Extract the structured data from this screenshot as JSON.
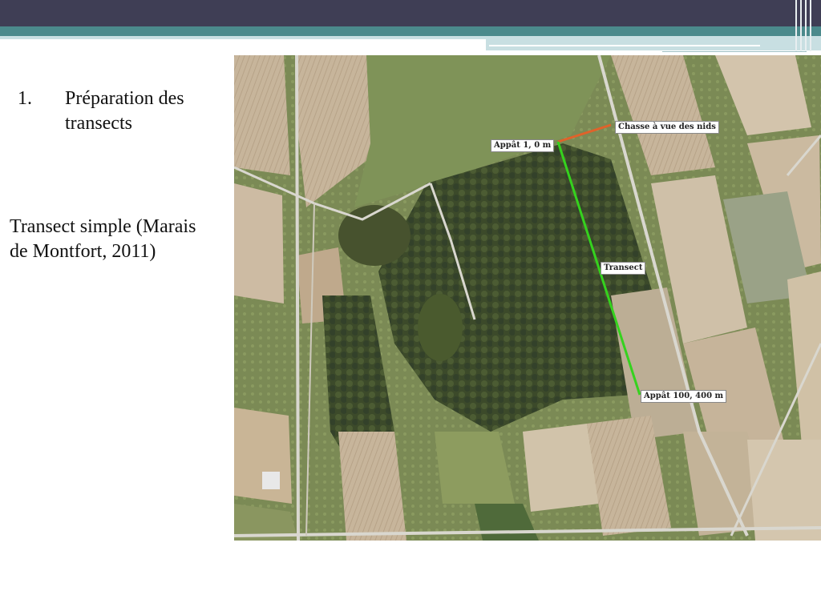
{
  "slide": {
    "list": [
      {
        "number": "1.",
        "text": "Préparation des transects"
      }
    ],
    "paragraph": "Transect simple (Marais de Montfort, 2011)"
  },
  "map": {
    "labels": {
      "nest_search": "Chasse à vue des nids",
      "bait_start": "Appât 1, 0 m",
      "transect": "Transect",
      "bait_end": "Appât 100, 400 m"
    },
    "colors": {
      "transect_line": "#35d21e",
      "nest_line": "#e0622a"
    }
  },
  "theme": {
    "header_dark": "#3f3e55",
    "header_teal": "#4b8a8c",
    "header_light": "#c8dfe2"
  }
}
